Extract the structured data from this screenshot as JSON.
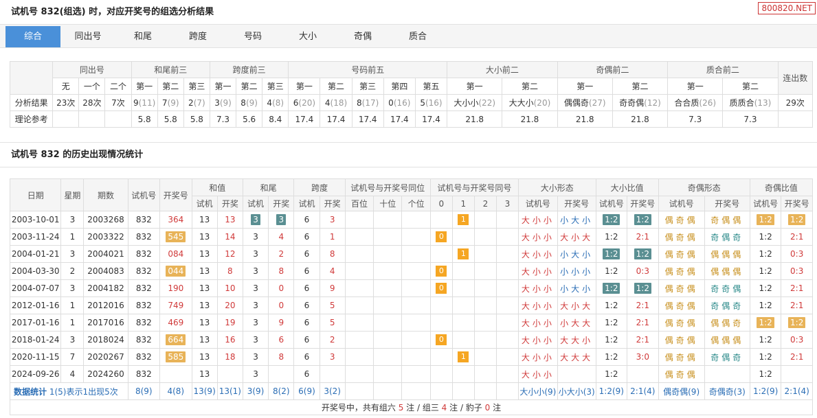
{
  "title1": "试机号 832(组选) 时，对应开奖号的组选分析结果",
  "brand": "800820.NET",
  "tabs": [
    "综合",
    "同出号",
    "和尾",
    "跨度",
    "号码",
    "大小",
    "奇偶",
    "质合"
  ],
  "analysis": {
    "groups": [
      "同出号",
      "和尾前三",
      "跨度前三",
      "号码前五",
      "大小前二",
      "奇偶前二",
      "质合前二",
      "连出数"
    ],
    "sub": [
      "无",
      "一个",
      "二个",
      "第一",
      "第二",
      "第三",
      "第一",
      "第二",
      "第三",
      "第一",
      "第二",
      "第三",
      "第四",
      "第五",
      "第一",
      "第二",
      "第一",
      "第二",
      "第一",
      "第二"
    ],
    "row1_label": "分析结果",
    "row1": [
      [
        "23次",
        ""
      ],
      [
        "28次",
        ""
      ],
      [
        "7次",
        ""
      ],
      [
        "9",
        "(11)"
      ],
      [
        "7",
        "(9)"
      ],
      [
        "2",
        "(7)"
      ],
      [
        "3",
        "(9)"
      ],
      [
        "8",
        "(9)"
      ],
      [
        "4",
        "(8)"
      ],
      [
        "6",
        "(20)"
      ],
      [
        "4",
        "(18)"
      ],
      [
        "8",
        "(17)"
      ],
      [
        "0",
        "(16)"
      ],
      [
        "5",
        "(16)"
      ],
      [
        "大小小",
        "(22)"
      ],
      [
        "大大小",
        "(20)"
      ],
      [
        "偶偶奇",
        "(27)"
      ],
      [
        "奇奇偶",
        "(12)"
      ],
      [
        "合合质",
        "(26)"
      ],
      [
        "质质合",
        "(13)"
      ],
      [
        "29次",
        ""
      ]
    ],
    "row2_label": "理论参考",
    "row2": [
      "",
      "",
      "",
      "5.8",
      "5.8",
      "5.8",
      "7.3",
      "5.6",
      "8.4",
      "17.4",
      "17.4",
      "17.4",
      "17.4",
      "17.4",
      "21.8",
      "21.8",
      "21.8",
      "21.8",
      "7.3",
      "7.3",
      ""
    ]
  },
  "title2": "试机号 832 的历史出现情况统计",
  "history": {
    "h1": [
      "日期",
      "星期",
      "期数",
      "试机号",
      "开奖号",
      "和值",
      "和尾",
      "跨度",
      "试机号与开奖号同位",
      "试机号与开奖号同号",
      "大小形态",
      "大小比值",
      "奇偶形态",
      "奇偶比值"
    ],
    "h2": [
      "试机",
      "开奖",
      "试机",
      "开奖",
      "试机",
      "开奖",
      "百位",
      "十位",
      "个位",
      "0",
      "1",
      "2",
      "3",
      "试机号",
      "开奖号",
      "试机号",
      "开奖号",
      "试机号",
      "开奖号",
      "试机号",
      "开奖号"
    ],
    "rows": [
      {
        "date": "2003-10-01",
        "wk": "3",
        "issue": "2003268",
        "test": "832",
        "draw": "364",
        "dhl": "",
        "hs": "13",
        "hd": "13",
        "ws": "3",
        "wd": "3",
        "whl": "t",
        "ks": "6",
        "kd": "3",
        "same": 1,
        "bss": "大小小",
        "bsd": "小大小",
        "brs": "1:2",
        "brd": "1:2",
        "brhl": "t",
        "oes": "偶奇偶",
        "oed": "奇偶偶",
        "ors": "1:2",
        "ord": "1:2",
        "orhl": "o"
      },
      {
        "date": "2003-11-24",
        "wk": "1",
        "issue": "2003322",
        "test": "832",
        "draw": "545",
        "dhl": "o",
        "hs": "13",
        "hd": "14",
        "ws": "3",
        "wd": "4",
        "whl": "",
        "ks": "6",
        "kd": "1",
        "same": 0,
        "bss": "大小小",
        "bsd": "大小大",
        "brs": "1:2",
        "brd": "2:1",
        "brhl": "",
        "oes": "偶奇偶",
        "oed": "奇偶奇",
        "ors": "1:2",
        "ord": "2:1",
        "orhl": ""
      },
      {
        "date": "2004-01-21",
        "wk": "3",
        "issue": "2004021",
        "test": "832",
        "draw": "084",
        "dhl": "",
        "hs": "13",
        "hd": "12",
        "ws": "3",
        "wd": "2",
        "whl": "",
        "ks": "6",
        "kd": "8",
        "same": 1,
        "bss": "大小小",
        "bsd": "小大小",
        "brs": "1:2",
        "brd": "1:2",
        "brhl": "t",
        "oes": "偶奇偶",
        "oed": "偶偶偶",
        "ors": "1:2",
        "ord": "0:3",
        "orhl": ""
      },
      {
        "date": "2004-03-30",
        "wk": "2",
        "issue": "2004083",
        "test": "832",
        "draw": "044",
        "dhl": "o",
        "hs": "13",
        "hd": "8",
        "ws": "3",
        "wd": "8",
        "whl": "",
        "ks": "6",
        "kd": "4",
        "same": 0,
        "bss": "大小小",
        "bsd": "小小小",
        "brs": "1:2",
        "brd": "0:3",
        "brhl": "",
        "oes": "偶奇偶",
        "oed": "偶偶偶",
        "ors": "1:2",
        "ord": "0:3",
        "orhl": ""
      },
      {
        "date": "2004-07-07",
        "wk": "3",
        "issue": "2004182",
        "test": "832",
        "draw": "190",
        "dhl": "",
        "hs": "13",
        "hd": "10",
        "ws": "3",
        "wd": "0",
        "whl": "",
        "ks": "6",
        "kd": "9",
        "same": 0,
        "bss": "大小小",
        "bsd": "小大小",
        "brs": "1:2",
        "brd": "1:2",
        "brhl": "t",
        "oes": "偶奇偶",
        "oed": "奇奇偶",
        "ors": "1:2",
        "ord": "2:1",
        "orhl": ""
      },
      {
        "date": "2012-01-16",
        "wk": "1",
        "issue": "2012016",
        "test": "832",
        "draw": "749",
        "dhl": "",
        "hs": "13",
        "hd": "20",
        "ws": "3",
        "wd": "0",
        "whl": "",
        "ks": "6",
        "kd": "5",
        "same": -1,
        "bss": "大小小",
        "bsd": "大小大",
        "brs": "1:2",
        "brd": "2:1",
        "brhl": "",
        "oes": "偶奇偶",
        "oed": "奇偶奇",
        "ors": "1:2",
        "ord": "2:1",
        "orhl": ""
      },
      {
        "date": "2017-01-16",
        "wk": "1",
        "issue": "2017016",
        "test": "832",
        "draw": "469",
        "dhl": "",
        "hs": "13",
        "hd": "19",
        "ws": "3",
        "wd": "9",
        "whl": "",
        "ks": "6",
        "kd": "5",
        "same": -1,
        "bss": "大小小",
        "bsd": "小大大",
        "brs": "1:2",
        "brd": "2:1",
        "brhl": "",
        "oes": "偶奇偶",
        "oed": "偶偶奇",
        "ors": "1:2",
        "ord": "1:2",
        "orhl": "o"
      },
      {
        "date": "2018-01-24",
        "wk": "3",
        "issue": "2018024",
        "test": "832",
        "draw": "664",
        "dhl": "o",
        "hs": "13",
        "hd": "16",
        "ws": "3",
        "wd": "6",
        "whl": "",
        "ks": "6",
        "kd": "2",
        "same": 0,
        "bss": "大小小",
        "bsd": "大大小",
        "brs": "1:2",
        "brd": "2:1",
        "brhl": "",
        "oes": "偶奇偶",
        "oed": "偶偶偶",
        "ors": "1:2",
        "ord": "0:3",
        "orhl": ""
      },
      {
        "date": "2020-11-15",
        "wk": "7",
        "issue": "2020267",
        "test": "832",
        "draw": "585",
        "dhl": "o",
        "hs": "13",
        "hd": "18",
        "ws": "3",
        "wd": "8",
        "whl": "",
        "ks": "6",
        "kd": "3",
        "same": 1,
        "bss": "大小小",
        "bsd": "大大大",
        "brs": "1:2",
        "brd": "3:0",
        "brhl": "",
        "oes": "偶奇偶",
        "oed": "奇偶奇",
        "ors": "1:2",
        "ord": "2:1",
        "orhl": ""
      },
      {
        "date": "2024-09-26",
        "wk": "4",
        "issue": "2024260",
        "test": "832",
        "draw": "",
        "dhl": "",
        "hs": "13",
        "hd": "",
        "ws": "3",
        "wd": "",
        "whl": "",
        "ks": "6",
        "kd": "",
        "same": -1,
        "bss": "大小小",
        "bsd": "",
        "brs": "1:2",
        "brd": "",
        "brhl": "",
        "oes": "偶奇偶",
        "oed": "",
        "ors": "1:2",
        "ord": "",
        "orhl": ""
      }
    ],
    "stats_label": "数据统计",
    "stats_note": "1(5)表示1出现5次",
    "stats": [
      "8(9)",
      "4(8)",
      "13(9)",
      "13(1)",
      "3(9)",
      "8(2)",
      "6(9)",
      "3(2)",
      "",
      "",
      "",
      "",
      "",
      "",
      "",
      "大小小(9)",
      "小大小(3)",
      "1:2(9)",
      "2:1(4)",
      "偶奇偶(9)",
      "奇偶奇(3)",
      "1:2(9)",
      "2:1(4)"
    ],
    "footer": {
      "a": "开奖号中，共有组六 ",
      "n6": "5",
      "b": " 注 / 组三 ",
      "n3": "4",
      "c": " 注 / 豹子 ",
      "nb": "0",
      "d": " 注"
    }
  }
}
